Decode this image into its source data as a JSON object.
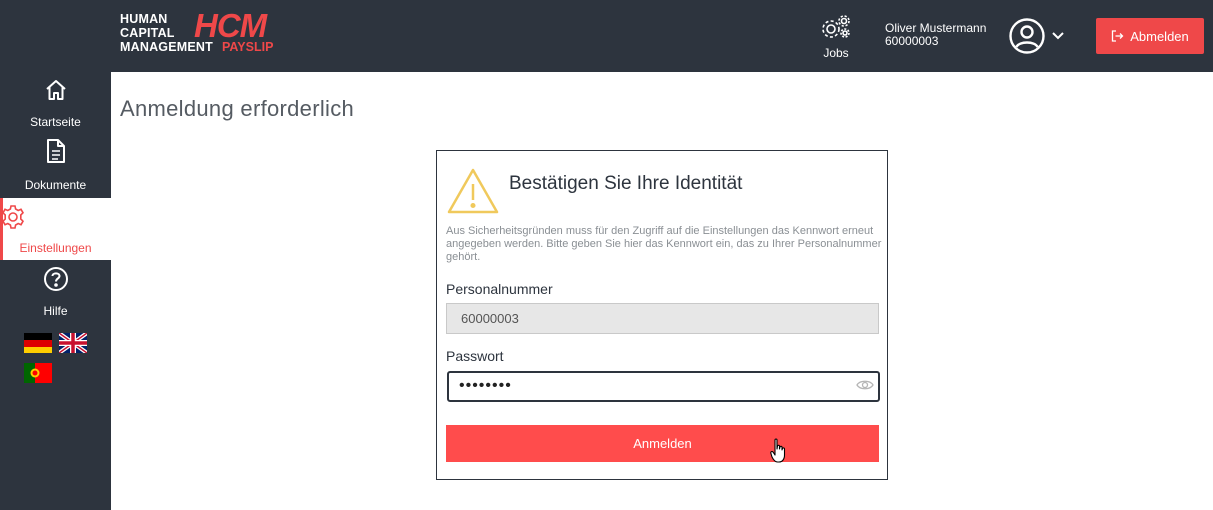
{
  "header": {
    "logo": {
      "line1": "HUMAN",
      "line2": "CAPITAL",
      "line3": "MANAGEMENT",
      "brand": "HCM",
      "sub": "PAYSLIP"
    },
    "jobs_label": "Jobs",
    "user_name": "Oliver Mustermann",
    "user_number": "60000003",
    "logout_label": "Abmelden"
  },
  "sidebar": {
    "items": [
      {
        "label": "Startseite",
        "icon": "home-icon"
      },
      {
        "label": "Dokumente",
        "icon": "document-icon"
      },
      {
        "label": "Einstellungen",
        "icon": "gear-icon",
        "active": true
      },
      {
        "label": "Hilfe",
        "icon": "help-icon"
      }
    ],
    "languages": [
      "german-flag",
      "english-flag",
      "portuguese-flag"
    ]
  },
  "main": {
    "page_title": "Anmeldung erforderlich",
    "card": {
      "title": "Bestätigen Sie Ihre Identität",
      "description": "Aus Sicherheitsgründen muss für den Zugriff auf die Einstellungen das Kennwort erneut angegeben werden. Bitte geben Sie hier das Kennwort ein, das zu Ihrer Personalnummer gehört.",
      "personal_number_label": "Personalnummer",
      "personal_number_value": "60000003",
      "password_label": "Passwort",
      "password_value": "••••••••",
      "submit_label": "Anmelden"
    }
  },
  "colors": {
    "accent": "#ef4849",
    "sidebar": "#2d343e",
    "warning": "#f0c95c"
  }
}
